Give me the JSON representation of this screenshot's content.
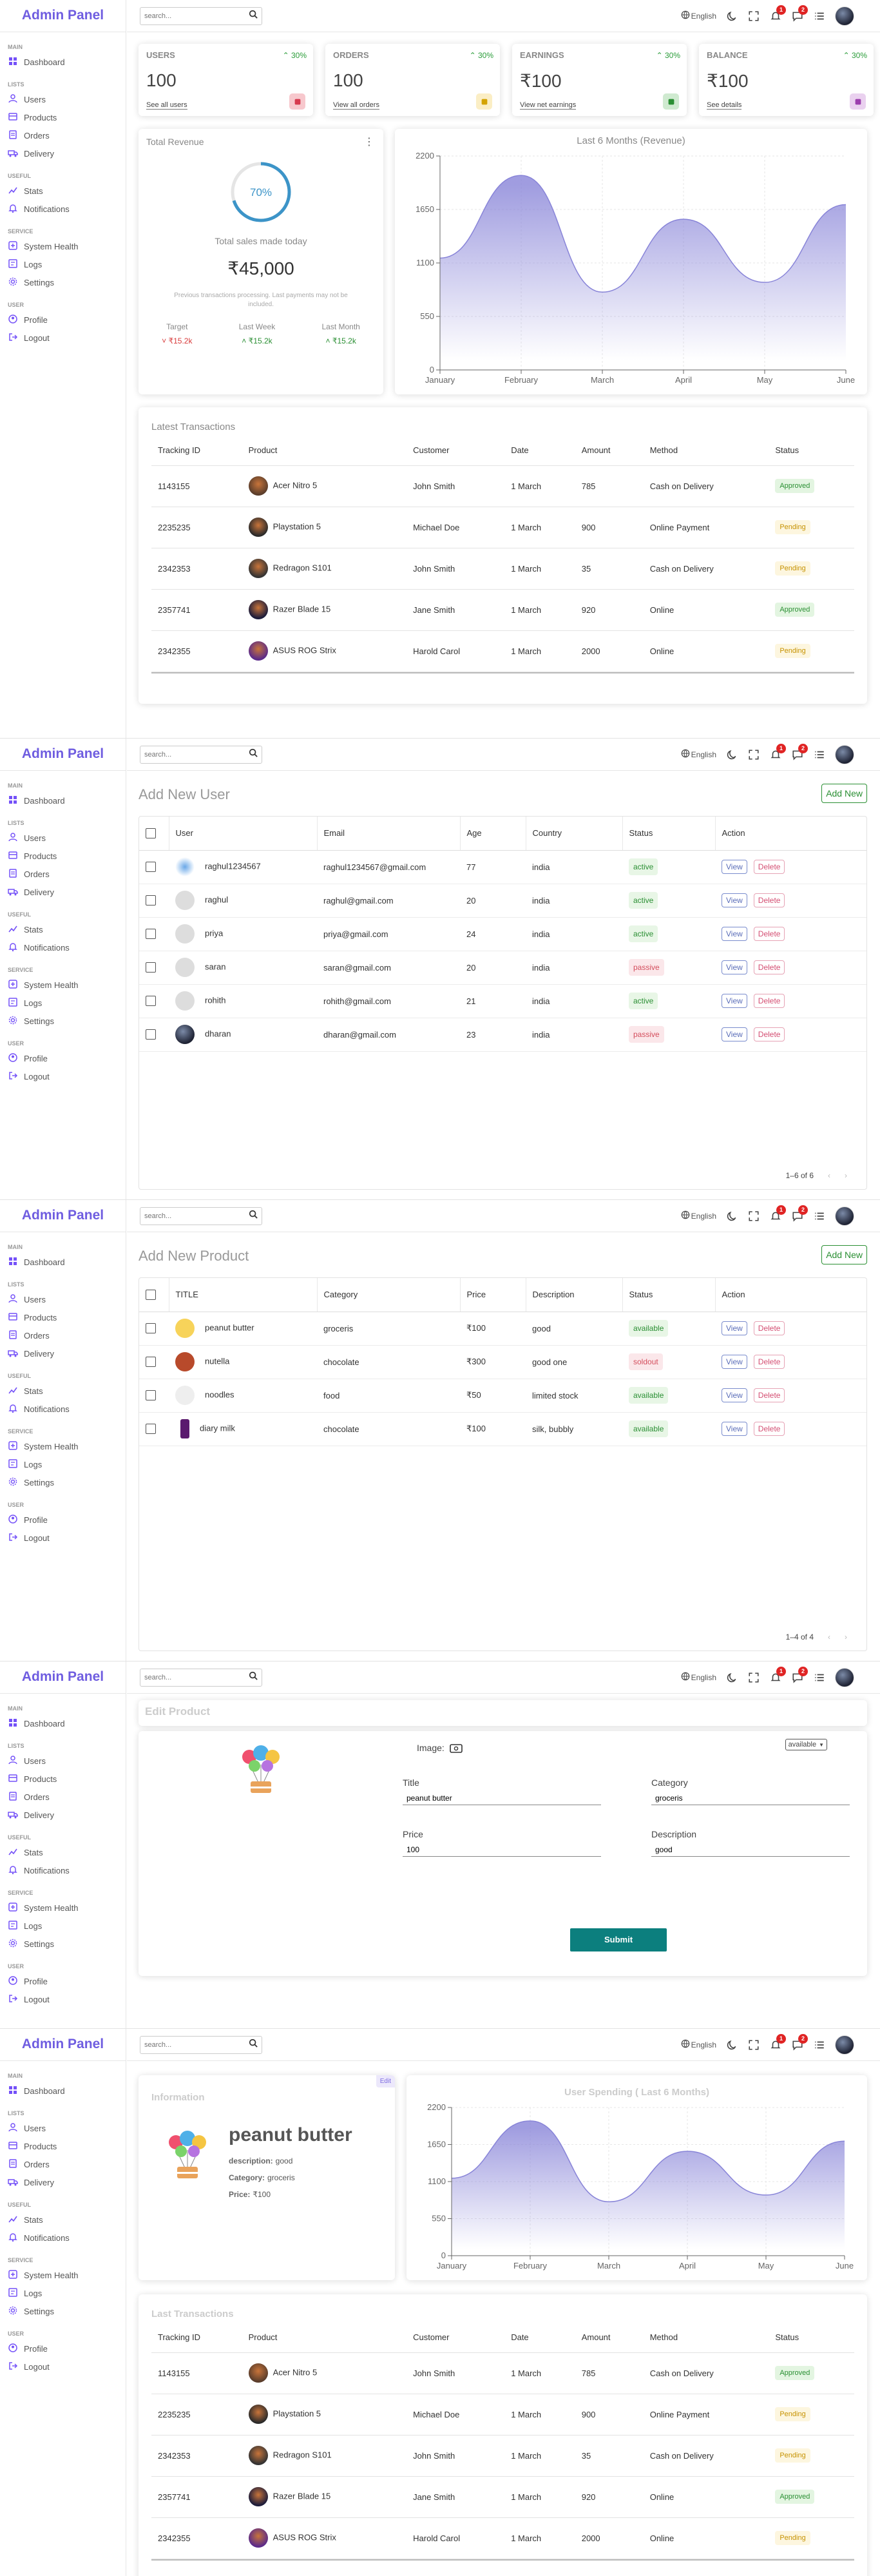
{
  "app": {
    "title": "Admin Panel"
  },
  "sidebar": {
    "sections": [
      {
        "title": "MAIN",
        "items": [
          {
            "label": "Dashboard",
            "icon": "dashboard-icon"
          }
        ]
      },
      {
        "title": "LISTS",
        "items": [
          {
            "label": "Users",
            "icon": "users-icon"
          },
          {
            "label": "Products",
            "icon": "products-icon"
          },
          {
            "label": "Orders",
            "icon": "orders-icon"
          },
          {
            "label": "Delivery",
            "icon": "delivery-icon"
          }
        ]
      },
      {
        "title": "USEFUL",
        "items": [
          {
            "label": "Stats",
            "icon": "stats-icon"
          },
          {
            "label": "Notifications",
            "icon": "bell-icon"
          }
        ]
      },
      {
        "title": "SERVICE",
        "items": [
          {
            "label": "System Health",
            "icon": "system-health-icon"
          },
          {
            "label": "Logs",
            "icon": "logs-icon"
          },
          {
            "label": "Settings",
            "icon": "settings-icon"
          }
        ]
      },
      {
        "title": "USER",
        "items": [
          {
            "label": "Profile",
            "icon": "profile-icon"
          },
          {
            "label": "Logout",
            "icon": "logout-icon"
          }
        ]
      }
    ]
  },
  "navbar": {
    "search_placeholder": "search...",
    "language": "English",
    "notifications_count": "1",
    "messages_count": "2"
  },
  "dashboard": {
    "widgets": [
      {
        "title": "USERS",
        "percent": "30%",
        "value": "100",
        "link": "See all users",
        "icon": "person-icon",
        "color": "#f7c8cd",
        "iconColor": "#d73a4e"
      },
      {
        "title": "ORDERS",
        "percent": "30%",
        "value": "100",
        "link": "View all orders",
        "icon": "cart-icon",
        "color": "#fbeec5",
        "iconColor": "#d4a300"
      },
      {
        "title": "EARNINGS",
        "percent": "30%",
        "value": "₹100",
        "link": "View net earnings",
        "icon": "money-icon",
        "color": "#cfead0",
        "iconColor": "#2a8f33"
      },
      {
        "title": "BALANCE",
        "percent": "30%",
        "value": "₹100",
        "link": "See details",
        "icon": "wallet-icon",
        "color": "#ead1ef",
        "iconColor": "#9c3fae"
      }
    ],
    "revenue": {
      "title": "Total Revenue",
      "progress": "70%",
      "progress_value": 0.7,
      "caption": "Total sales made today",
      "amount": "₹45,000",
      "note": "Previous transactions processing. Last payments may not be included.",
      "summary": [
        {
          "label": "Target",
          "value": "₹15.2k",
          "trend": "down"
        },
        {
          "label": "Last Week",
          "value": "₹15.2k",
          "trend": "up"
        },
        {
          "label": "Last Month",
          "value": "₹15.2k",
          "trend": "up"
        }
      ]
    },
    "transactions_title": "Latest Transactions"
  },
  "transactions": {
    "headers": [
      "Tracking ID",
      "Product",
      "Customer",
      "Date",
      "Amount",
      "Method",
      "Status"
    ],
    "rows": [
      {
        "id": "1143155",
        "product": "Acer Nitro 5",
        "customer": "John Smith",
        "date": "1 March",
        "amount": "785",
        "method": "Cash on Delivery",
        "status": "Approved"
      },
      {
        "id": "2235235",
        "product": "Playstation 5",
        "customer": "Michael Doe",
        "date": "1 March",
        "amount": "900",
        "method": "Online Payment",
        "status": "Pending"
      },
      {
        "id": "2342353",
        "product": "Redragon S101",
        "customer": "John Smith",
        "date": "1 March",
        "amount": "35",
        "method": "Cash on Delivery",
        "status": "Pending"
      },
      {
        "id": "2357741",
        "product": "Razer Blade 15",
        "customer": "Jane Smith",
        "date": "1 March",
        "amount": "920",
        "method": "Online",
        "status": "Approved"
      },
      {
        "id": "2342355",
        "product": "ASUS ROG Strix",
        "customer": "Harold Carol",
        "date": "1 March",
        "amount": "2000",
        "method": "Online",
        "status": "Pending"
      }
    ]
  },
  "users_page": {
    "title": "Add New User",
    "add_button": "Add New",
    "pagination": "1–6 of 6",
    "headers": [
      "User",
      "Email",
      "Age",
      "Country",
      "Status",
      "Action"
    ],
    "rows": [
      {
        "name": "raghul1234567",
        "email": "raghul1234567@gmail.com",
        "age": "77",
        "country": "india",
        "status": "active"
      },
      {
        "name": "raghul",
        "email": "raghul@gmail.com",
        "age": "20",
        "country": "india",
        "status": "active"
      },
      {
        "name": "priya",
        "email": "priya@gmail.com",
        "age": "24",
        "country": "india",
        "status": "active"
      },
      {
        "name": "saran",
        "email": "saran@gmail.com",
        "age": "20",
        "country": "india",
        "status": "passive"
      },
      {
        "name": "rohith",
        "email": "rohith@gmail.com",
        "age": "21",
        "country": "india",
        "status": "active"
      },
      {
        "name": "dharan",
        "email": "dharan@gmail.com",
        "age": "23",
        "country": "india",
        "status": "passive"
      }
    ],
    "view": "View",
    "delete": "Delete"
  },
  "products_page": {
    "title": "Add New Product",
    "add_button": "Add New",
    "pagination": "1–4 of 4",
    "headers": [
      "TITLE",
      "Category",
      "Price",
      "Description",
      "Status",
      "Action"
    ],
    "rows": [
      {
        "title": "peanut butter",
        "category": "groceris",
        "price": "₹100",
        "description": "good",
        "status": "available"
      },
      {
        "title": "nutella",
        "category": "chocolate",
        "price": "₹300",
        "description": "good one",
        "status": "soldout"
      },
      {
        "title": "noodles",
        "category": "food",
        "price": "₹50",
        "description": "limited stock",
        "status": "available"
      },
      {
        "title": "diary milk",
        "category": "chocolate",
        "price": "₹100",
        "description": "silk, bubbly",
        "status": "available"
      }
    ]
  },
  "edit_page": {
    "title": "Edit Product",
    "image_label": "Image:",
    "status_value": "available",
    "fields": [
      {
        "label": "Title",
        "value": "peanut butter"
      },
      {
        "label": "Category",
        "value": "groceris"
      },
      {
        "label": "Price",
        "value": "100"
      },
      {
        "label": "Description",
        "value": "good"
      }
    ],
    "submit": "Submit"
  },
  "single_page": {
    "info_title": "Information",
    "edit": "Edit",
    "name": "peanut butter",
    "details": [
      {
        "key": "description:",
        "value": "good"
      },
      {
        "key": "Category:",
        "value": "groceris"
      },
      {
        "key": "Price:",
        "value": "₹100"
      }
    ],
    "chart_title": "User Spending ( Last 6 Months)",
    "transactions_title": "Last Transactions"
  },
  "chart_data": [
    {
      "type": "area",
      "title": "Last 6 Months (Revenue)",
      "categories": [
        "January",
        "February",
        "March",
        "April",
        "May",
        "June"
      ],
      "values": [
        1150,
        2000,
        800,
        1550,
        900,
        1700
      ],
      "yticks": [
        0,
        550,
        1100,
        1650,
        2200
      ],
      "ylim": [
        0,
        2200
      ],
      "xlabel": "",
      "ylabel": "",
      "grid": true
    },
    {
      "type": "area",
      "title": "User Spending ( Last 6 Months)",
      "categories": [
        "January",
        "February",
        "March",
        "April",
        "May",
        "June"
      ],
      "values": [
        1150,
        2000,
        800,
        1550,
        900,
        1700
      ],
      "yticks": [
        0,
        550,
        1100,
        1650,
        2200
      ],
      "ylim": [
        0,
        2200
      ],
      "xlabel": "",
      "ylabel": "",
      "grid": true
    }
  ],
  "colors": {
    "accent": "#6f5de0",
    "chart": "#8884d8",
    "approved": "#2a8f33",
    "pending": "#c69200",
    "submit": "#0c7f7e"
  }
}
